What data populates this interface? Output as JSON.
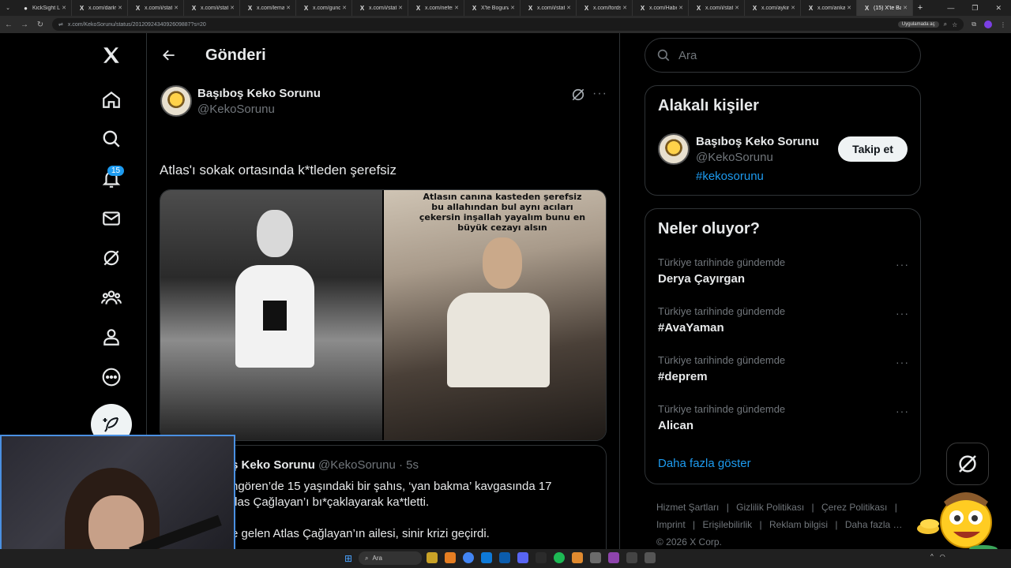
{
  "browser": {
    "tabs": [
      {
        "title": "KickSight Lin"
      },
      {
        "title": "x.com/darkw"
      },
      {
        "title": "x.com/i/statu"
      },
      {
        "title": "x.com/i/statu"
      },
      {
        "title": "x.com/lemar"
      },
      {
        "title": "x.com/gunde"
      },
      {
        "title": "x.com/i/statu"
      },
      {
        "title": "x.com/nefes"
      },
      {
        "title": "X'te Boguna"
      },
      {
        "title": "x.com/i/statu"
      },
      {
        "title": "x.com/fordsi"
      },
      {
        "title": "x.com/Haber"
      },
      {
        "title": "x.com/i/statu"
      },
      {
        "title": "x.com/aykiri"
      },
      {
        "title": "x.com/ankara"
      },
      {
        "title": "(15) X'te Baş"
      }
    ],
    "url": "x.com/KekoSorunu/status/2012092434092609887?s=20",
    "url_pill": "Uygulamada aç"
  },
  "header": {
    "title": "Gönderi"
  },
  "post": {
    "author_name": "Başıboş Keko Sorunu",
    "author_handle": "@KekoSorunu",
    "text": "Atlas'ı sokak ortasında k*tleden şerefsiz",
    "image_overlay_text": "Atlasın canına kasteden şerefsiz bu allahından bul aynı acıları çekersin inşallah yayalım bunu en büyük cezayı alsın"
  },
  "quote": {
    "author_name": "Başıboş Keko Sorunu",
    "author_handle": "@KekoSorunu",
    "time": "· 5s",
    "line1": "ngören’de 15 yaşındaki bir şahıs, ‘yan bakma’ kavgasında 17",
    "line2": "tlas Çağlayan’ı bı*çaklayarak ka*tletti.",
    "line3": "e gelen Atlas Çağlayan’ın ailesi, sinir krizi geçirdi."
  },
  "nav": {
    "notification_count": "15"
  },
  "search": {
    "placeholder": "Ara"
  },
  "related": {
    "title": "Alakalı kişiler",
    "name": "Başıboş Keko Sorunu",
    "handle": "@KekoSorunu",
    "tag": "#kekosorunu",
    "follow_label": "Takip et"
  },
  "trends": {
    "title": "Neler oluyor?",
    "items": [
      {
        "context": "Türkiye tarihinde gündemde",
        "name": "Derya Çayırgan"
      },
      {
        "context": "Türkiye tarihinde gündemde",
        "name": "#AvaYaman"
      },
      {
        "context": "Türkiye tarihinde gündemde",
        "name": "#deprem"
      },
      {
        "context": "Türkiye tarihinde gündemde",
        "name": "Alican"
      }
    ],
    "show_more": "Daha fazla göster"
  },
  "footer": {
    "links": [
      "Hizmet Şartları",
      "|",
      "Gizlilik Politikası",
      "|",
      "Çerez Politikası",
      "|",
      "Imprint",
      "|",
      "Erişilebilirlik",
      "|",
      "Reklam bilgisi",
      "|",
      "Daha fazla …"
    ],
    "copyright": "© 2026 X Corp."
  },
  "taskbar": {
    "search_placeholder": "Ara"
  },
  "colors": {
    "accent": "#1d9bf0",
    "background": "#000000",
    "text": "#e7e9ea",
    "muted": "#71767b",
    "border": "#2f3336"
  }
}
